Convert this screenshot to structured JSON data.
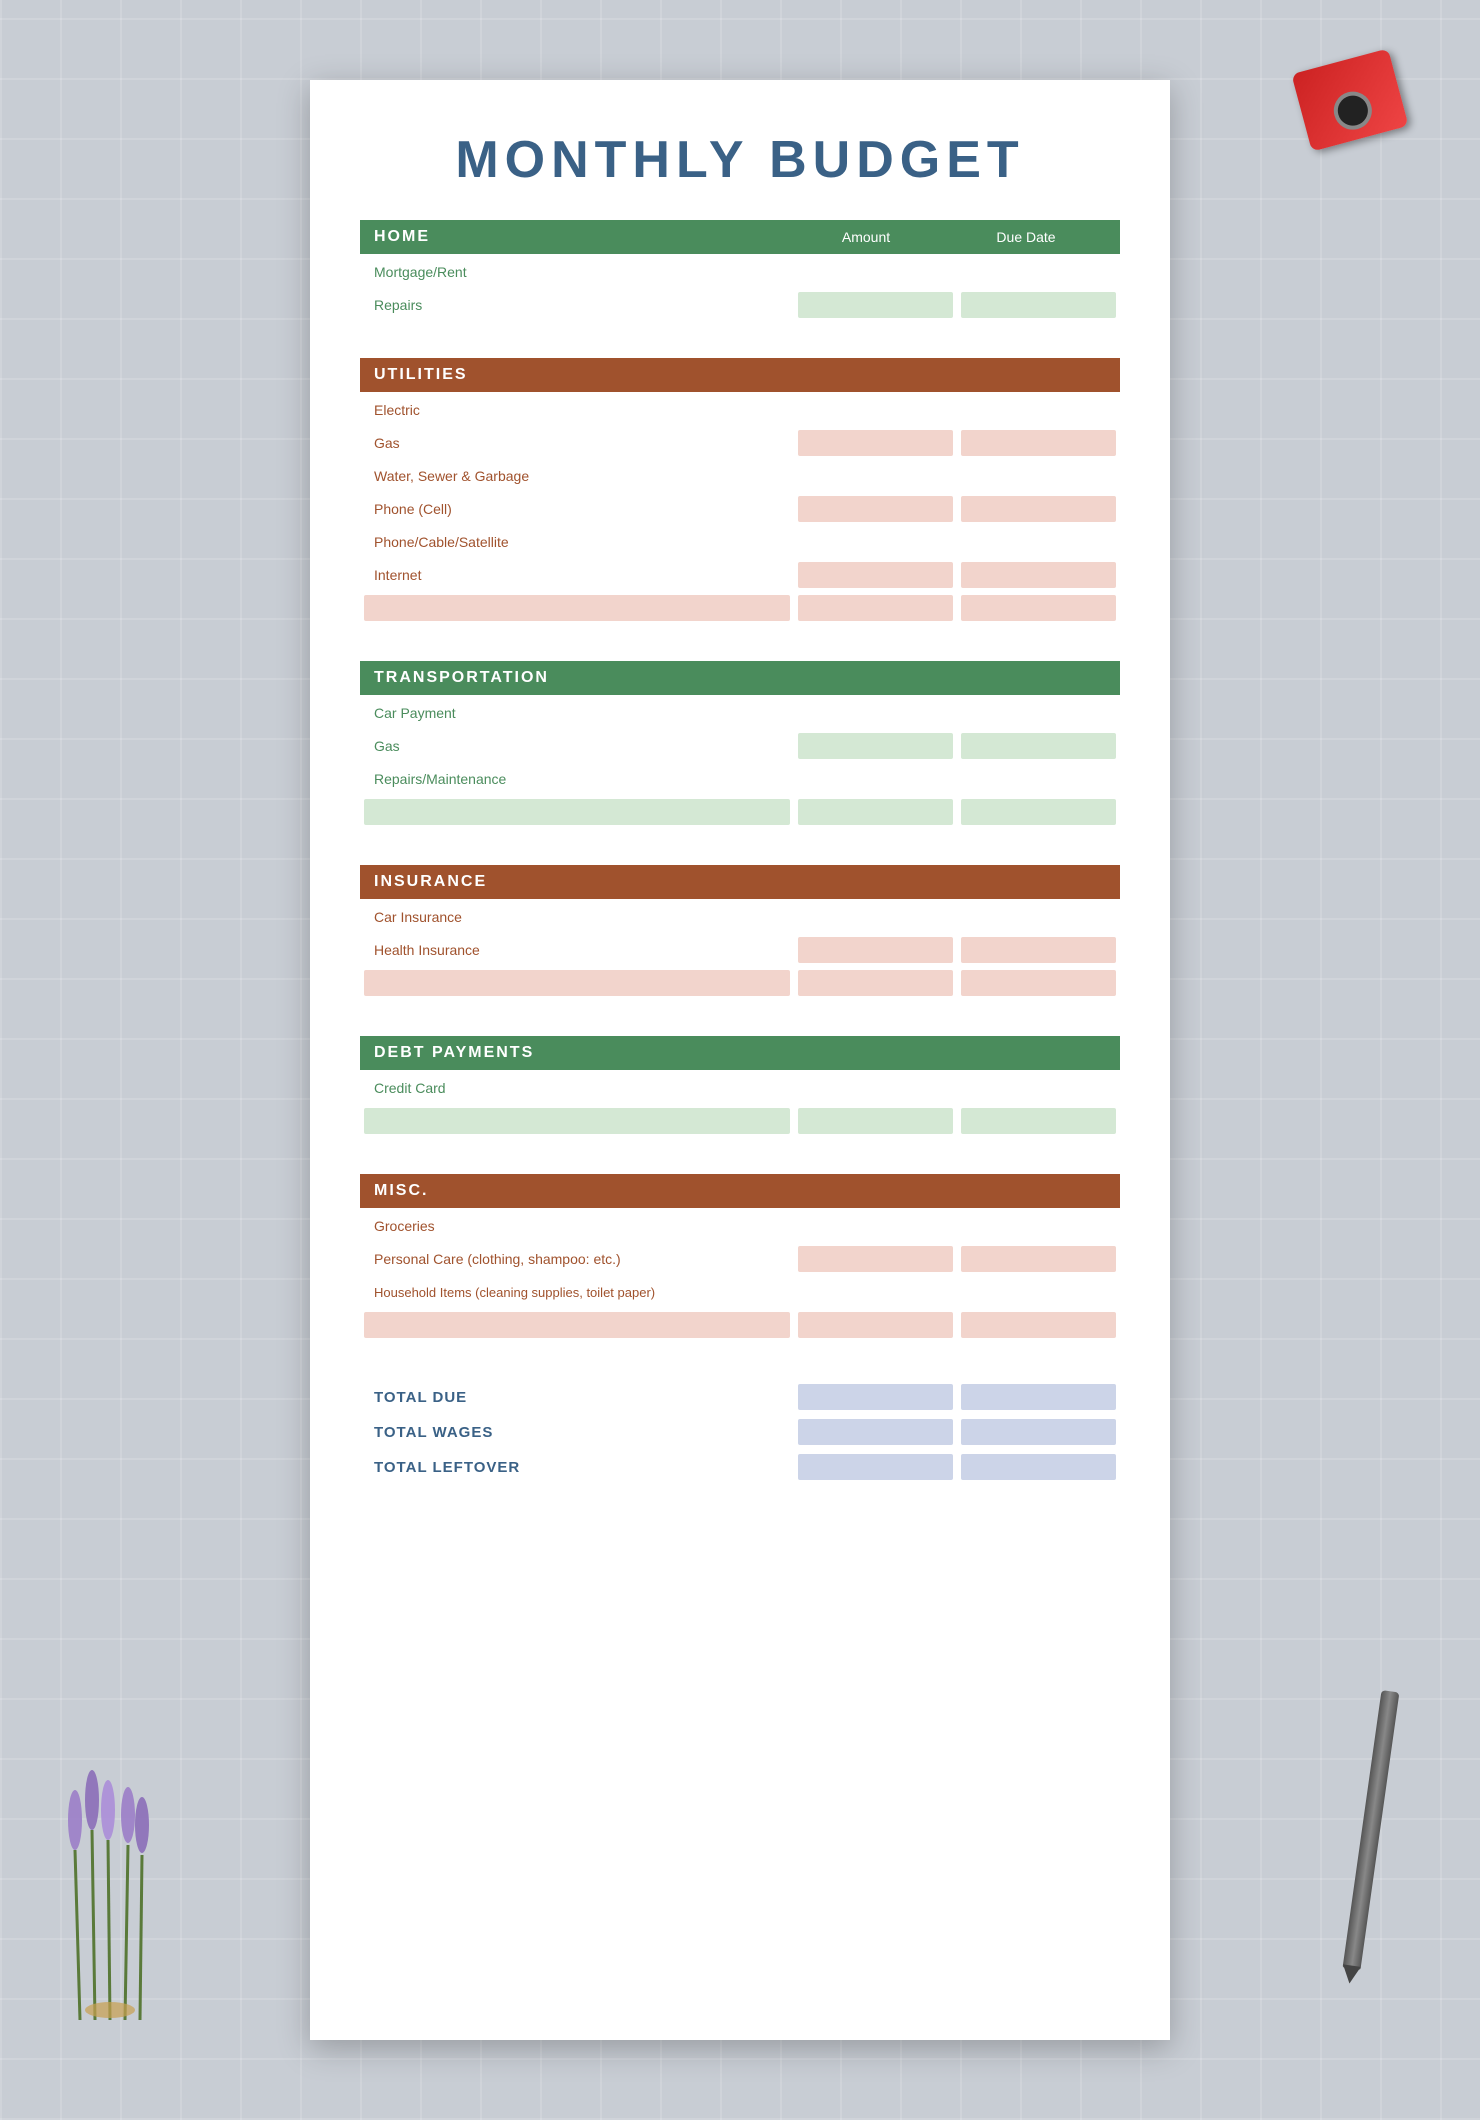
{
  "page": {
    "title": "MONTHLY BUDGET",
    "background_color": "#c8cdd4"
  },
  "sections": [
    {
      "id": "home",
      "label": "HOME",
      "color": "green",
      "col_amount": "Amount",
      "col_due": "Due Date",
      "rows": [
        {
          "id": "mortgage",
          "label": "Mortgage/Rent",
          "color": "green"
        },
        {
          "id": "repairs",
          "label": "Repairs",
          "color": "green"
        }
      ]
    },
    {
      "id": "utilities",
      "label": "UTILITIES",
      "color": "brown",
      "rows": [
        {
          "id": "electric",
          "label": "Electric",
          "color": "pink"
        },
        {
          "id": "gas-util",
          "label": "Gas",
          "color": "pink"
        },
        {
          "id": "water",
          "label": "Water, Sewer & Garbage",
          "color": "pink"
        },
        {
          "id": "phone-cell",
          "label": "Phone (Cell)",
          "color": "pink"
        },
        {
          "id": "cable",
          "label": "Phone/Cable/Satellite",
          "color": "pink"
        },
        {
          "id": "internet",
          "label": "Internet",
          "color": "pink"
        },
        {
          "id": "util-extra",
          "label": "",
          "color": "pink"
        }
      ]
    },
    {
      "id": "transportation",
      "label": "TRANSPORTATION",
      "color": "green",
      "rows": [
        {
          "id": "car-payment",
          "label": "Car Payment",
          "color": "green"
        },
        {
          "id": "gas-trans",
          "label": "Gas",
          "color": "green"
        },
        {
          "id": "repairs-maint",
          "label": "Repairs/Maintenance",
          "color": "green"
        },
        {
          "id": "trans-extra",
          "label": "",
          "color": "green"
        }
      ]
    },
    {
      "id": "insurance",
      "label": "INSURANCE",
      "color": "brown",
      "rows": [
        {
          "id": "car-insurance",
          "label": "Car Insurance",
          "color": "pink"
        },
        {
          "id": "health-insurance",
          "label": "Health Insurance",
          "color": "pink"
        },
        {
          "id": "ins-extra",
          "label": "",
          "color": "pink"
        }
      ]
    },
    {
      "id": "debt",
      "label": "DEBT PAYMENTS",
      "color": "green",
      "rows": [
        {
          "id": "credit-card",
          "label": "Credit Card",
          "color": "green"
        },
        {
          "id": "debt-extra",
          "label": "",
          "color": "green"
        }
      ]
    },
    {
      "id": "misc",
      "label": "MISC.",
      "color": "brown",
      "rows": [
        {
          "id": "groceries",
          "label": "Groceries",
          "color": "pink"
        },
        {
          "id": "personal-care",
          "label": "Personal Care (clothing, shampoo: etc.)",
          "color": "pink"
        },
        {
          "id": "household",
          "label": "Household Items (cleaning supplies, toilet paper)",
          "color": "pink"
        },
        {
          "id": "misc-extra",
          "label": "",
          "color": "pink"
        }
      ]
    }
  ],
  "totals": [
    {
      "id": "total-due",
      "label": "TOTAL DUE",
      "color": "blue"
    },
    {
      "id": "total-wages",
      "label": "TOTAL WAGES",
      "color": "blue"
    },
    {
      "id": "total-leftover",
      "label": "TOTAL LEFTOVER",
      "color": "blue"
    }
  ]
}
